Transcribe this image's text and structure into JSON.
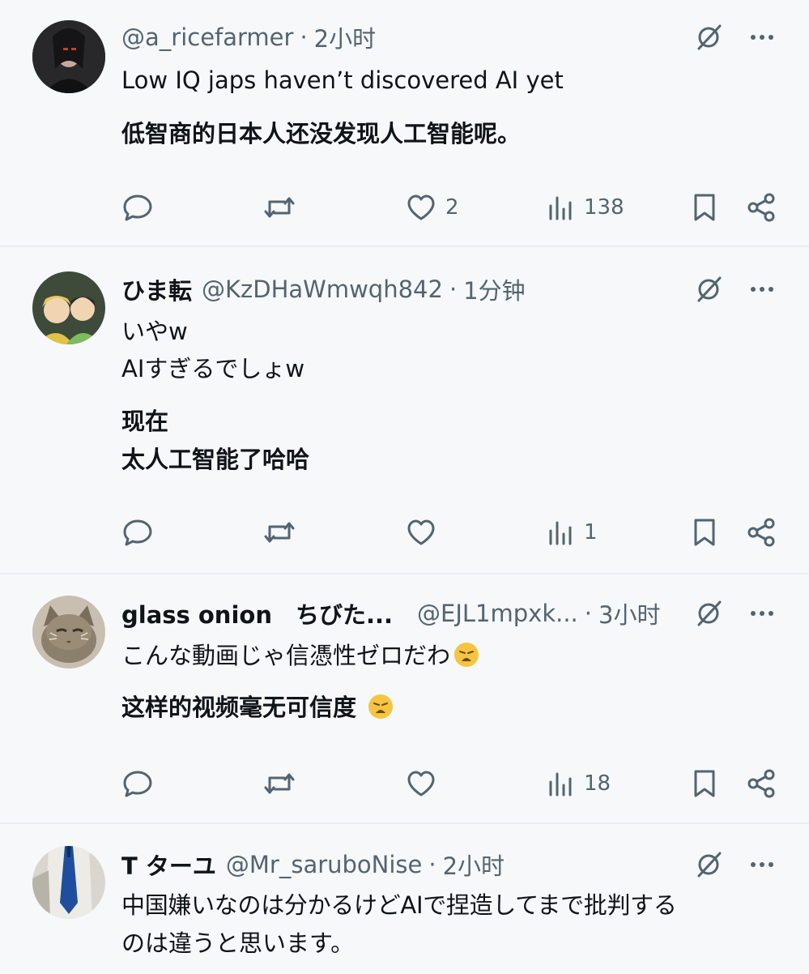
{
  "posts": [
    {
      "display_name": "",
      "handle": "@a_ricefarmer",
      "separator": "·",
      "time": "2小时",
      "lines": [
        "Low IQ japs haven’t discovered AI yet"
      ],
      "translation": [
        "低智商的日本人还没发现人工智能呢。"
      ],
      "stats": {
        "replies": "",
        "reposts": "",
        "likes": "2",
        "views": "138"
      },
      "avatar_icon": "dark-portrait-avatar"
    },
    {
      "display_name": "ひま転",
      "handle": "@KzDHaWmwqh842",
      "separator": "·",
      "time": "1分钟",
      "lines": [
        "いやw",
        "AIすぎるでしょw"
      ],
      "translation": [
        "现在",
        "太人工智能了哈哈"
      ],
      "stats": {
        "replies": "",
        "reposts": "",
        "likes": "",
        "views": "1"
      },
      "avatar_icon": "anime-characters-avatar"
    },
    {
      "display_name": "glass onion　ちびた...",
      "handle": "@EJL1mpxk...",
      "separator": "·",
      "time": "3小时",
      "lines": [
        "こんな動画じゃ信憑性ゼロだわ"
      ],
      "translation": [
        "这样的视频毫无可信度 "
      ],
      "stats": {
        "replies": "",
        "reposts": "",
        "likes": "",
        "views": "18"
      },
      "avatar_icon": "cat-avatar"
    },
    {
      "display_name": "T ターユ",
      "handle": "@Mr_saruboNise",
      "separator": "·",
      "time": "2小时",
      "lines": [
        "中国嫌いなのは分かるけどAIで捏造してまで批判する",
        "のは違うと思います。"
      ],
      "translation": [],
      "stats": {
        "replies": "",
        "reposts": "",
        "likes": "",
        "views": ""
      },
      "avatar_icon": "person-blue-tie-avatar"
    }
  ],
  "icons": {
    "grok": "grok-slash-icon",
    "more": "more-dots-icon",
    "reply": "reply-bubble-icon",
    "repost": "repost-arrows-icon",
    "like": "heart-icon",
    "views": "views-bar-chart-icon",
    "bookmark": "bookmark-icon",
    "share": "share-icon",
    "emoji": "weary-face-emoji"
  },
  "colors": {
    "text": "#0f1419",
    "muted": "#536471",
    "background": "#f7f8fa"
  }
}
